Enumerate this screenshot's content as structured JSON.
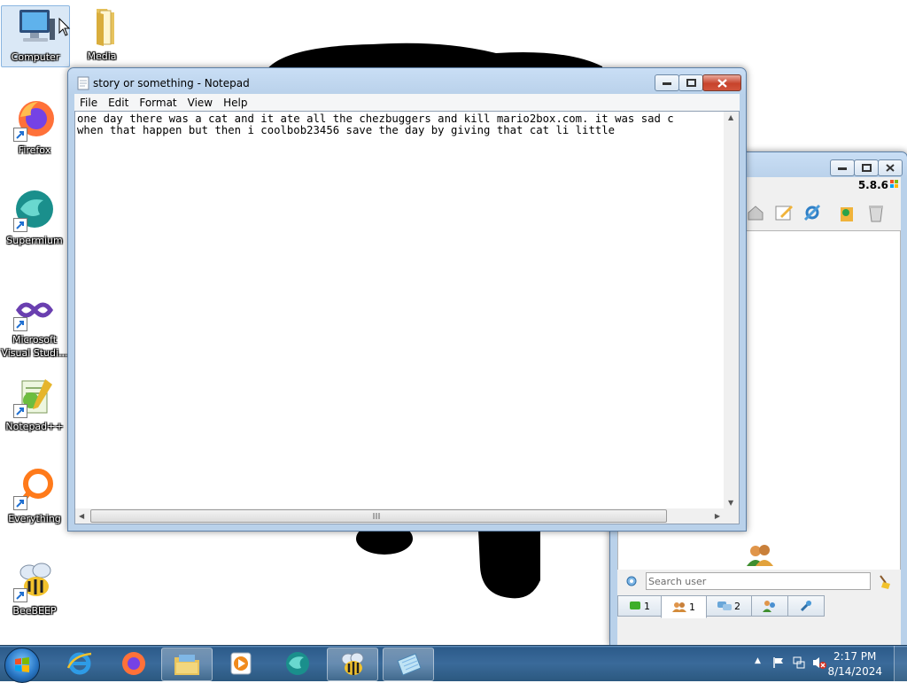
{
  "desktop": {
    "icons": [
      {
        "label": "Computer",
        "icon": "computer-icon"
      },
      {
        "label": "Media",
        "icon": "folder-icon"
      },
      {
        "label": "Firefox",
        "icon": "firefox-icon"
      },
      {
        "label": "Supermium",
        "icon": "supermium-icon"
      },
      {
        "label": "Microsoft Visual Studi...",
        "icon": "visual-studio-icon"
      },
      {
        "label": "Notepad++",
        "icon": "notepadpp-icon"
      },
      {
        "label": "Everything",
        "icon": "everything-icon"
      },
      {
        "label": "BeeBEEP",
        "icon": "beebeep-icon"
      }
    ]
  },
  "notepad": {
    "title": "story or something - Notepad",
    "menu": [
      "File",
      "Edit",
      "Format",
      "View",
      "Help"
    ],
    "lines": [
      "one day there was a cat and it ate all the chezbuggers and kill mario2box.com. it was sad c",
      "when that happen but then i coolbob23456 save the day by giving that cat li little"
    ]
  },
  "beebeep": {
    "version": "5.8.6",
    "search_placeholder": "Search user",
    "tabs": [
      {
        "icon": "chat-icon",
        "count": "1"
      },
      {
        "icon": "users-icon",
        "count": "1"
      },
      {
        "icon": "messages-icon",
        "count": "2"
      },
      {
        "icon": "groups-icon",
        "count": ""
      },
      {
        "icon": "plugin-icon",
        "count": ""
      }
    ]
  },
  "taskbar": {
    "time": "2:17 PM",
    "date": "8/14/2024"
  },
  "colors": {
    "taskbar": "#2c5b8a",
    "window_frame": "#b9d1ea",
    "close_button": "#c7432b"
  }
}
